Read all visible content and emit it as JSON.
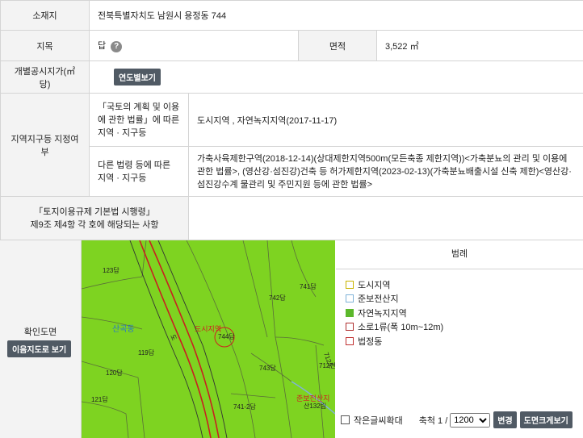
{
  "rows": {
    "location": {
      "label": "소재지",
      "value": "전북특별자치도 남원시 용정동 744"
    },
    "land_category": {
      "label": "지목",
      "value": "답",
      "help_icon": "?"
    },
    "area": {
      "label": "면적",
      "value": "3,522 ㎡"
    },
    "official_price": {
      "label": "개별공시지가(㎡당)",
      "button": "연도별보기"
    },
    "zoning": {
      "label": "지역지구등 지정여부",
      "sub1_label": "「국토의 계획 및 이용에 관한 법률」에 따른 지역 · 지구등",
      "sub1_value": "도시지역 , 자연녹지지역(2017-11-17)",
      "sub2_label": "다른 법령 등에 따른 지역 · 지구등",
      "sub2_value": "가축사육제한구역(2018-12-14)(상대제한지역500m(모든축종 제한지역))<가축분뇨의 관리 및 이용에 관한 법률>, (영산강·섬진강)건축 등 허가제한지역(2023-02-13)(가축분뇨배출시설 신축 제한)<영산강·섬진강수계 물관리 및 주민지원 등에 관한 법률>"
    },
    "decree": {
      "label_line1": "「토지이용규제 기본법 시행령」",
      "label_line2": "제9조 제4항 각 호에 해당되는 사항",
      "value": ""
    }
  },
  "confirm_map": {
    "label": "확인도면",
    "button": "이음지도로 보기"
  },
  "map_labels": {
    "l123": "123답",
    "l742": "742답",
    "l741": "741답",
    "l744": "744답",
    "l119": "119답",
    "l120": "120답",
    "l121": "121답",
    "l743": "743답",
    "l741_2": "741-2답",
    "l712": "712전",
    "l132": "산132림",
    "sangokdong": "산곡동",
    "dosi": "도시지역",
    "junbo": "준보전산지",
    "road": "도",
    "road2": "712도"
  },
  "legend": {
    "title": "범례",
    "items": [
      {
        "label": "도시지역",
        "border": "#c8b400",
        "fill": "#ffffff"
      },
      {
        "label": "준보전산지",
        "border": "#7fb2d8",
        "fill": "#ffffff"
      },
      {
        "label": "자연녹지지역",
        "border": "#5cb82b",
        "fill": "#5cb82b"
      },
      {
        "label": "소로1류(폭 10m~12m)",
        "border": "#b03030",
        "fill": "#ffffff"
      },
      {
        "label": "법정동",
        "border": "#c03030",
        "fill": "#ffffff"
      }
    ]
  },
  "footer": {
    "enlarge_label": "작은글씨확대",
    "scale_label": "축척 1 /",
    "scale_value": "1200",
    "change_button": "변경",
    "large_view_button": "도면크게보기"
  },
  "colors": {
    "map_green": "#7ed321",
    "header_bg": "#f3f3f3",
    "button_bg": "#505a64"
  }
}
